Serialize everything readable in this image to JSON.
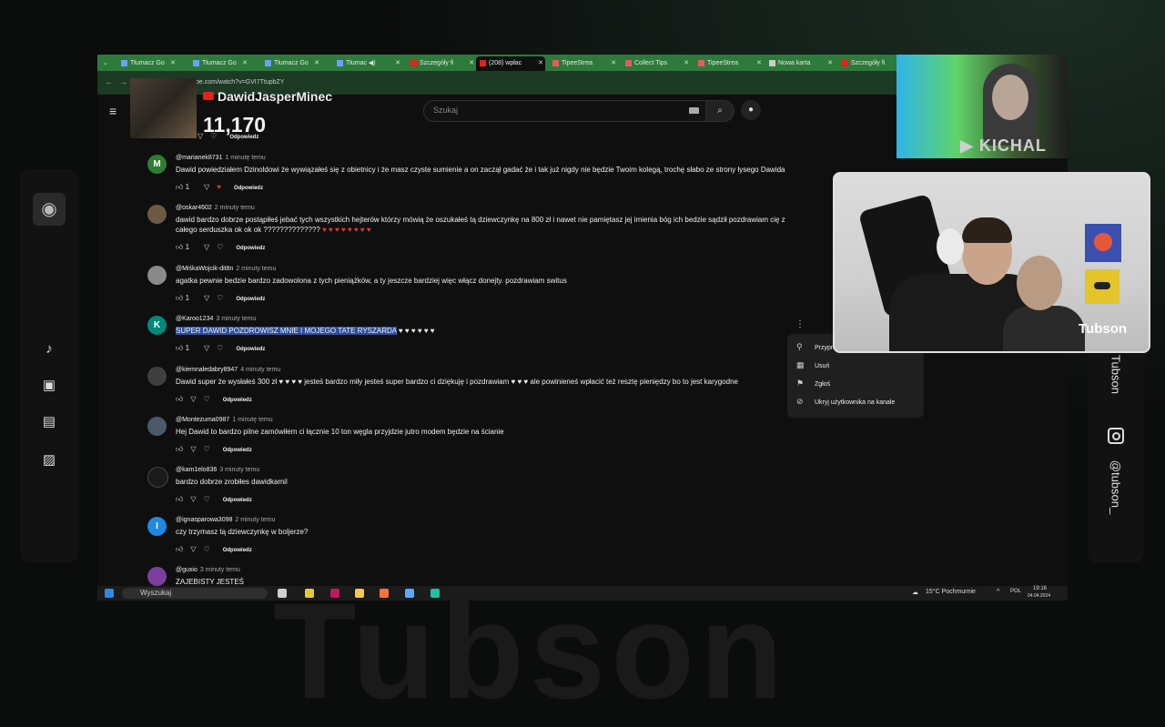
{
  "background_word": "Tubson",
  "left_sidebar": {
    "icons": [
      "music-icon",
      "video-icon",
      "film-icon",
      "image-icon"
    ]
  },
  "right_sidebar": {
    "name": "Tubson",
    "instagram": "@tubson_"
  },
  "browser": {
    "tabs": [
      {
        "label": "Tłumacz Go"
      },
      {
        "label": "Tłumacz Go"
      },
      {
        "label": "Tłumacz Go"
      },
      {
        "label": "Tłumac"
      },
      {
        "label": "Szczegóły fi"
      },
      {
        "label": "(208) wpłac"
      },
      {
        "label": "TipeeStrea"
      },
      {
        "label": "Collect Tips"
      },
      {
        "label": "TipeeStrea"
      },
      {
        "label": "Nowa karta"
      },
      {
        "label": "Szczegóły fi"
      }
    ],
    "url": "be.com/watch?v=GVI7TtupbZY"
  },
  "youtube": {
    "search_placeholder": "Szukaj"
  },
  "overlay": {
    "channel_name": "DawidJasperMinec",
    "count": "11,170"
  },
  "comments": [
    {
      "author": "@marianek8731",
      "time": "1 minutę temu",
      "avatar_letter": "M",
      "avatar_color": "#2e7d32",
      "text": "Dawid powiedziałem Dzinoldowi że wywiązałeś się z obietnicy i że masz czyste sumienie a on zaczął gadać że i tak już nigdy nie będzie Twoim kolegą, trochę słabo ze strony łysego Dawida",
      "likes": "1",
      "reply": "Odpowiedz"
    },
    {
      "author": "@oskar4602",
      "time": "2 minuty temu",
      "avatar_letter": "",
      "avatar_color": "#6d5a44",
      "text": "dawid bardzo dobrze postąpiłeś jebać tych wszystkich hejterów którzy mówią że oszukałeś tą dziewczynkę na 800 zł i nawet nie pamiętasz jej imienia bóg ich bedzie sądził pozdrawiam cię z całego serduszka ok ok ok ??????????????",
      "hearts": "♥ ♥ ♥ ♥ ♥ ♥ ♥ ♥",
      "likes": "1",
      "reply": "Odpowiedz"
    },
    {
      "author": "@MiśkaWojcik-dit8n",
      "time": "2 minuty temu",
      "avatar_letter": "",
      "avatar_color": "#8a8a8a",
      "text": "agatka pewnie bedzie bardzo zadowolona z tych pieniążków, a ty jeszcze bardziej więc włącz donejty. pozdrawiam switus",
      "likes": "1",
      "reply": "Odpowiedz"
    },
    {
      "author": "@Karoo1234",
      "time": "3 minuty temu",
      "avatar_letter": "K",
      "avatar_color": "#00897b",
      "text": "SUPER DAWID POZDROWISZ MNIE I MOJEGO TATE RYSZARDA",
      "hearts_white": "♥ ♥ ♥ ♥ ♥ ♥",
      "likes": "1",
      "reply": "Odpowiedz"
    },
    {
      "author": "@kiemnaledabry8947",
      "time": "4 minuty temu",
      "avatar_letter": "",
      "avatar_color": "#3f3f3f",
      "text": "Dawid super że wysłałeś 300 zł ♥ ♥ ♥ ♥ jesteś bardzo miły jesteś super bardzo ci dziękuję i pozdrawiam ♥ ♥ ♥ ale powinieneś wpłacić też resztę pieniędzy bo to jest karygodne",
      "likes": "",
      "reply": "Odpowiedz"
    },
    {
      "author": "@Montezuma0987",
      "time": "1 minutę temu",
      "avatar_letter": "",
      "avatar_color": "#4a5a6a",
      "text": "Hej Dawid to bardzo pilne zamówiłem ci łącznie 10 ton węgla przyjdzie jutro modem będzie na ścianie",
      "likes": "",
      "reply": "Odpowiedz"
    },
    {
      "author": "@kam1elo836",
      "time": "3 minuty temu",
      "avatar_letter": "",
      "avatar_color": "#1a1a1a",
      "text": "bardzo dobrze zrobiłes dawidkamil",
      "likes": "",
      "reply": "Odpowiedz"
    },
    {
      "author": "@ignasparowa3098",
      "time": "2 minuty temu",
      "avatar_letter": "I",
      "avatar_color": "#1e88e5",
      "text": "czy trzymasz tą dziewczynkę w boljerze?",
      "likes": "",
      "reply": "Odpowiedz"
    },
    {
      "author": "@guxio",
      "time": "3 minuty temu",
      "avatar_letter": "",
      "avatar_color": "#7b3fa0",
      "text": "ZAJEBISTY JESTEŚ",
      "likes": "",
      "reply": ""
    }
  ],
  "context_menu": {
    "items": [
      {
        "label": "Przypnij",
        "icon": "pin-icon"
      },
      {
        "label": "Usuń",
        "icon": "trash-icon"
      },
      {
        "label": "Zgłoś",
        "icon": "flag-icon"
      },
      {
        "label": "Ukryj użytkownika na kanale",
        "icon": "block-icon"
      }
    ]
  },
  "taskbar": {
    "search": "Wyszukaj",
    "weather": "15°C Pochmurnie",
    "lang": "POL",
    "time": "19:16",
    "date": "04.04.2024"
  },
  "webcam_top": {
    "watermark": "KICHAL"
  },
  "webcam_main": {
    "watermark": "Tubson"
  }
}
